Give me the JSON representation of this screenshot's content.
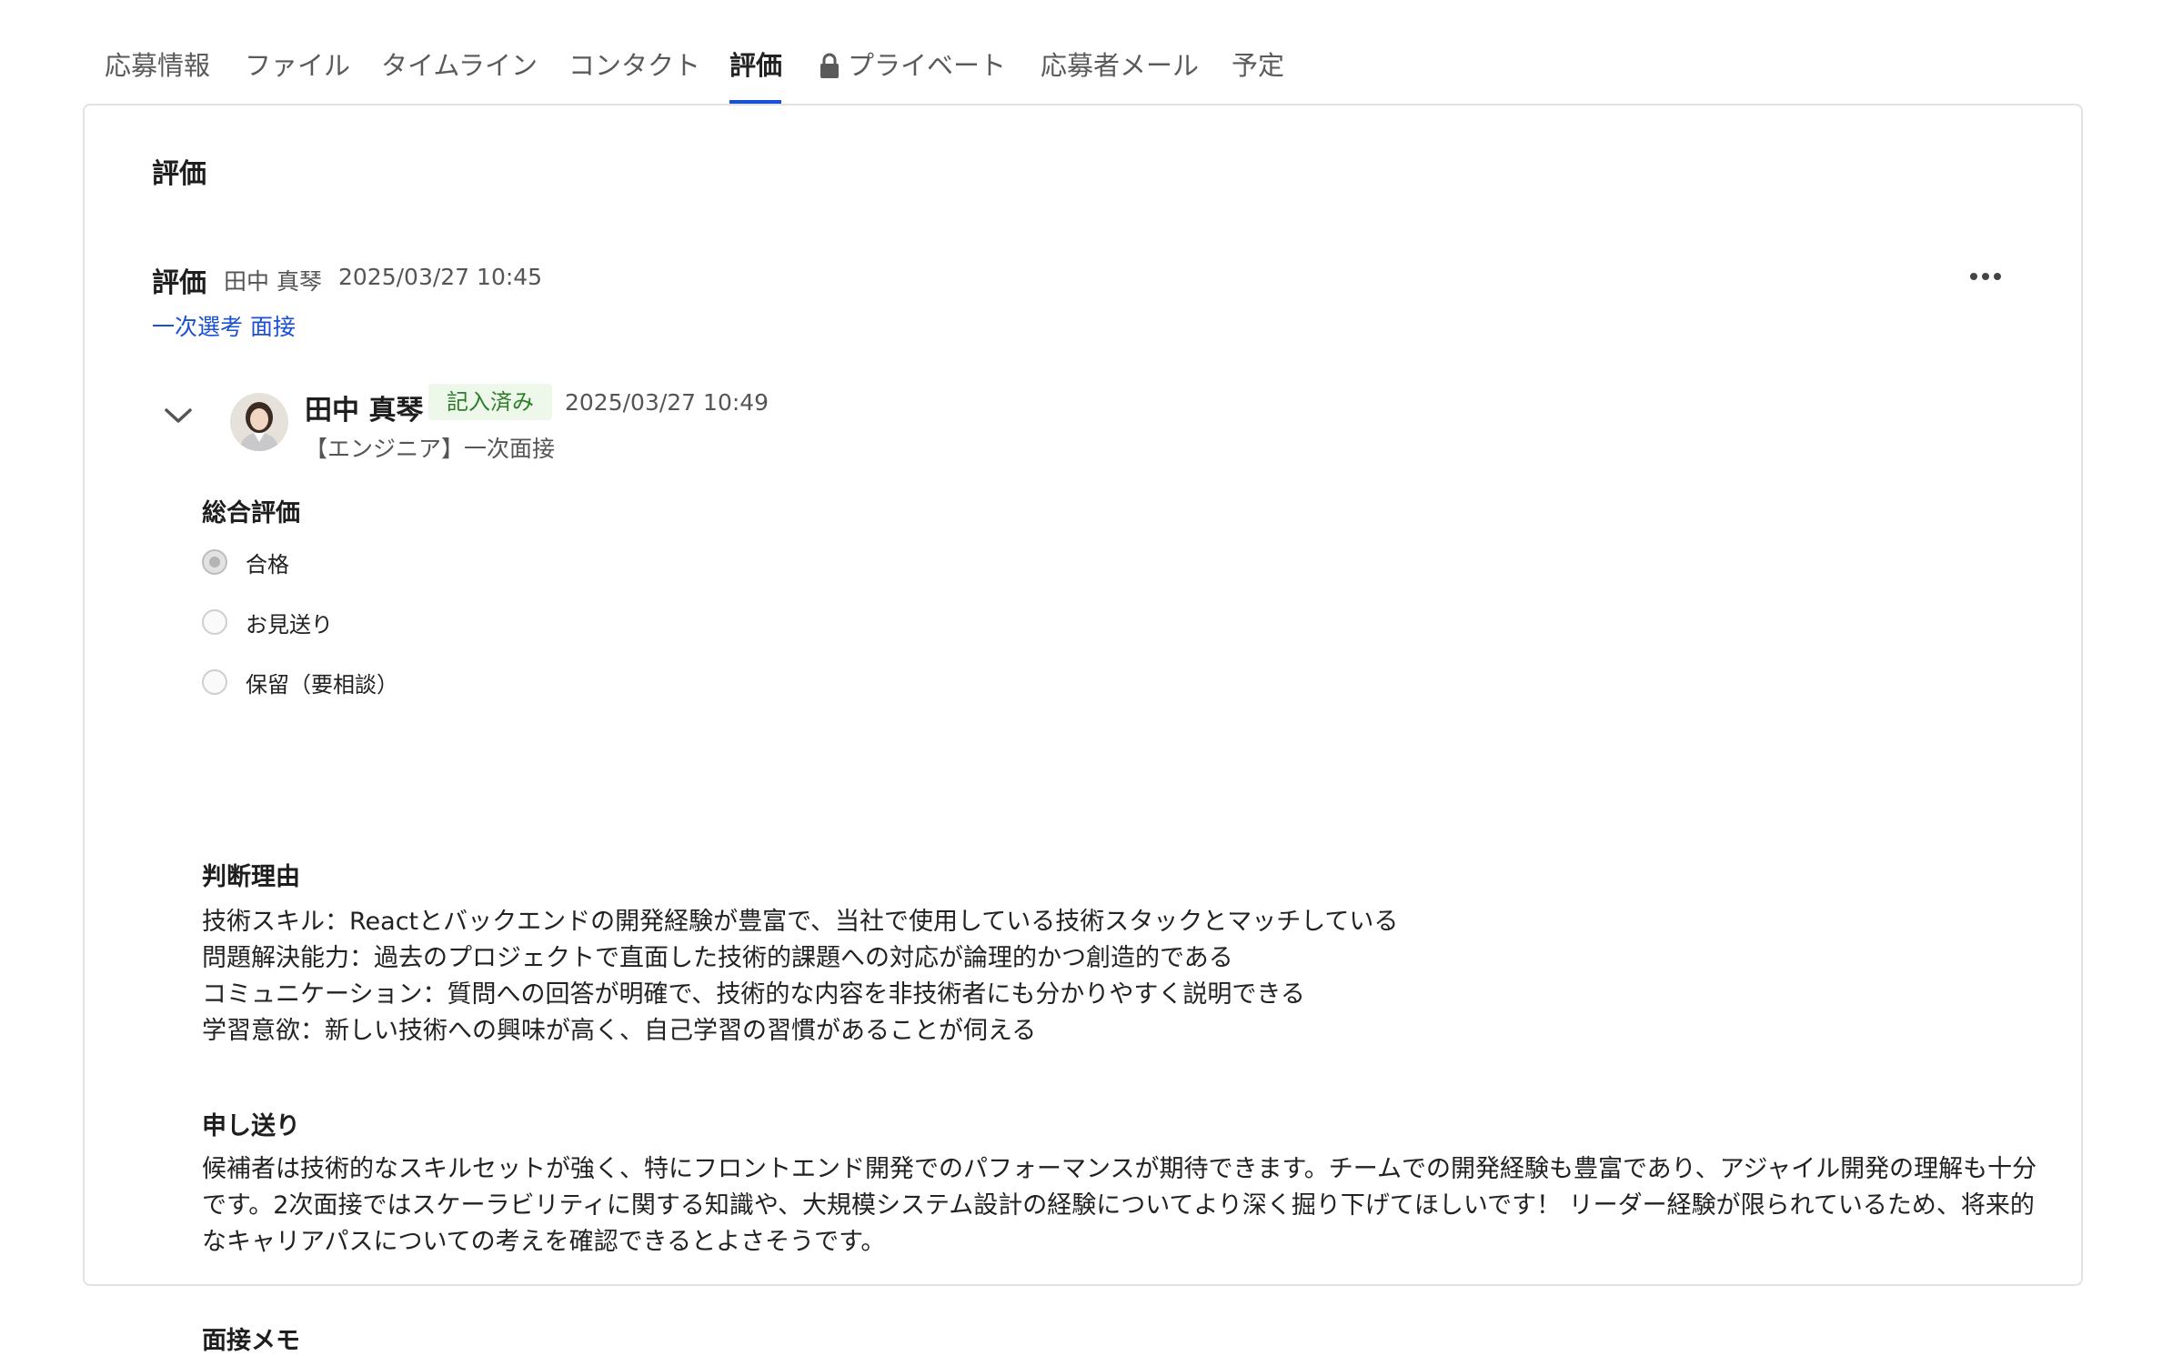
{
  "tabs": [
    {
      "label": "応募情報"
    },
    {
      "label": "ファイル"
    },
    {
      "label": "タイムライン"
    },
    {
      "label": "コンタクト"
    },
    {
      "label": "評価"
    },
    {
      "label": "プライベート",
      "icon": "lock-icon"
    },
    {
      "label": "応募者メール"
    },
    {
      "label": "予定"
    }
  ],
  "active_tab": "評価",
  "accent_color": "#1a4fd6",
  "section": {
    "title": "評価"
  },
  "evaluation": {
    "title": "評価",
    "author": "田中 真琴",
    "date": "2025/03/27 10:45",
    "stage_link": "一次選考 面接"
  },
  "reviewer": {
    "name": "田中 真琴",
    "status_badge": "記入済み",
    "date": "2025/03/27 10:49",
    "subtitle": "【エンジニア】一次面接"
  },
  "overall": {
    "label": "総合評価",
    "options": [
      {
        "label": "合格",
        "selected": true
      },
      {
        "label": "お見送り",
        "selected": false
      },
      {
        "label": "保留（要相談）",
        "selected": false
      }
    ]
  },
  "reason": {
    "label": "判断理由",
    "lines": [
      "技術スキル：Reactとバックエンドの開発経験が豊富で、当社で使用している技術スタックとマッチしている",
      "問題解決能力：過去のプロジェクトで直面した技術的課題への対応が論理的かつ創造的である",
      "コミュニケーション：質問への回答が明確で、技術的な内容を非技術者にも分かりやすく説明できる",
      "学習意欲：新しい技術への興味が高く、自己学習の習慣があることが伺える"
    ]
  },
  "handover": {
    "label": "申し送り",
    "text": "候補者は技術的なスキルセットが強く、特にフロントエンド開発でのパフォーマンスが期待できます。チームでの開発経験も豊富であり、アジャイル開発の理解も十分です。2次面接ではスケーラビリティに関する知識や、大規模システム設計の経験についてより深く掘り下げてほしいです！ リーダー経験が限られているため、将来的なキャリアパスについての考えを確認できるとよさそうです。"
  },
  "memo": {
    "label": "面接メモ"
  }
}
